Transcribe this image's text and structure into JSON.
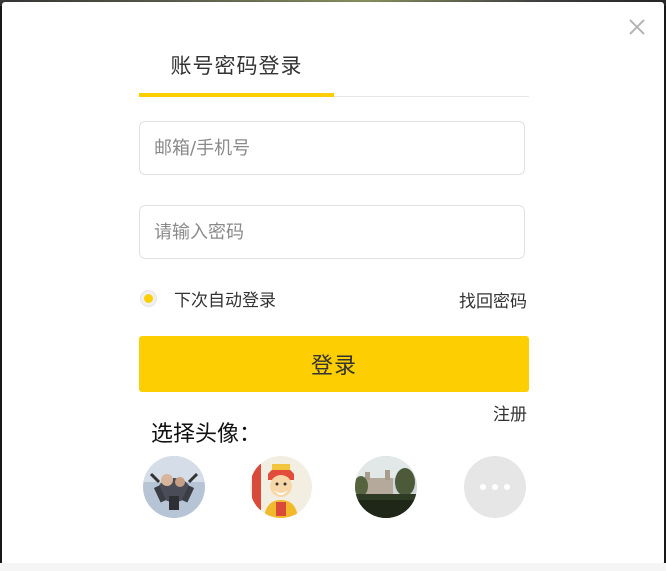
{
  "modal": {
    "close_icon": "close-icon",
    "tabs": [
      {
        "label": "账号密码登录",
        "active": true
      }
    ],
    "email": {
      "placeholder": "邮箱/手机号",
      "value": ""
    },
    "password": {
      "placeholder": "请输入密码",
      "value": ""
    },
    "remember": {
      "label": "下次自动登录",
      "checked": true
    },
    "forgot_label": "找回密码",
    "login_label": "登录",
    "register_label": "注册",
    "avatar_title": "选择头像：",
    "avatars": [
      {
        "icon": "skydiver-avatar"
      },
      {
        "icon": "cartoon-god-avatar"
      },
      {
        "icon": "castle-avatar"
      },
      {
        "icon": "more-icon"
      }
    ]
  },
  "colors": {
    "accent": "#fdce02",
    "text": "#333333",
    "border": "#e2e2e2",
    "more_bg": "#e6e6e6"
  }
}
